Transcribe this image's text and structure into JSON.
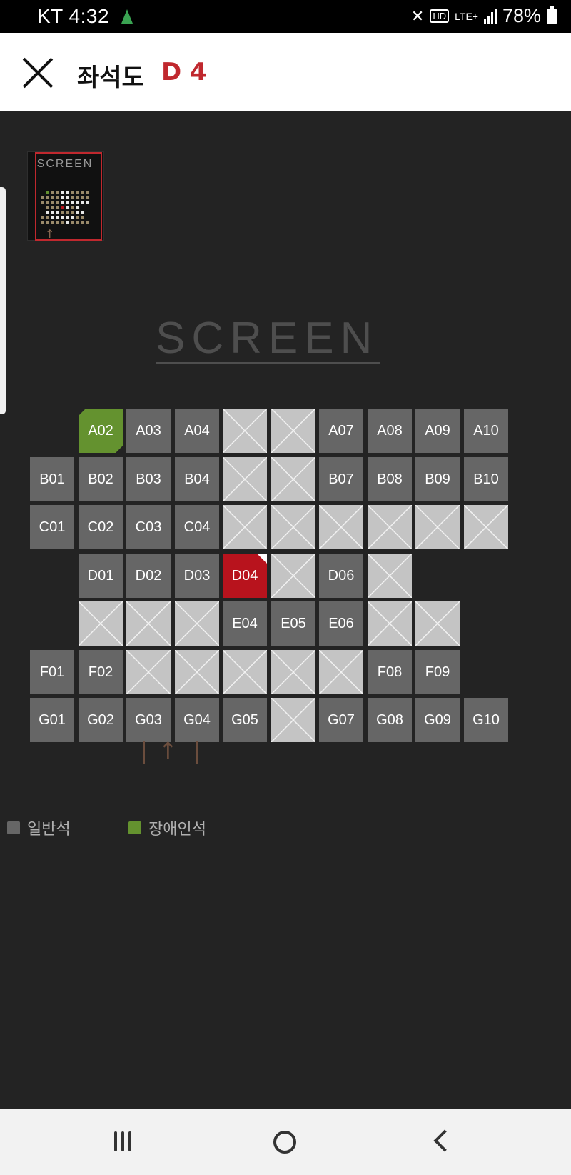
{
  "status": {
    "carrier_time": "KT 4:32",
    "hd": "HD",
    "lte": "LTE+",
    "battery": "78%"
  },
  "header": {
    "title": "좌석도",
    "seat": "D 4"
  },
  "minimap": {
    "screen_label": "SCREEN"
  },
  "screen": {
    "label": "SCREEN"
  },
  "seats": [
    {
      "id": "A02",
      "label": "A02",
      "status": "wheelchair",
      "row": 0,
      "col": 1
    },
    {
      "id": "A03",
      "label": "A03",
      "status": "available",
      "row": 0,
      "col": 2
    },
    {
      "id": "A04",
      "label": "A04",
      "status": "available",
      "row": 0,
      "col": 3
    },
    {
      "id": "A05",
      "label": "",
      "status": "blocked",
      "row": 0,
      "col": 4
    },
    {
      "id": "A06",
      "label": "",
      "status": "blocked",
      "row": 0,
      "col": 5
    },
    {
      "id": "A07",
      "label": "A07",
      "status": "available",
      "row": 0,
      "col": 6
    },
    {
      "id": "A08",
      "label": "A08",
      "status": "available",
      "row": 0,
      "col": 7
    },
    {
      "id": "A09",
      "label": "A09",
      "status": "available",
      "row": 0,
      "col": 8
    },
    {
      "id": "A10",
      "label": "A10",
      "status": "available",
      "row": 0,
      "col": 9
    },
    {
      "id": "B01",
      "label": "B01",
      "status": "available",
      "row": 1,
      "col": 0
    },
    {
      "id": "B02",
      "label": "B02",
      "status": "available",
      "row": 1,
      "col": 1
    },
    {
      "id": "B03",
      "label": "B03",
      "status": "available",
      "row": 1,
      "col": 2
    },
    {
      "id": "B04",
      "label": "B04",
      "status": "available",
      "row": 1,
      "col": 3
    },
    {
      "id": "B05",
      "label": "",
      "status": "blocked",
      "row": 1,
      "col": 4
    },
    {
      "id": "B06",
      "label": "",
      "status": "blocked",
      "row": 1,
      "col": 5
    },
    {
      "id": "B07",
      "label": "B07",
      "status": "available",
      "row": 1,
      "col": 6
    },
    {
      "id": "B08",
      "label": "B08",
      "status": "available",
      "row": 1,
      "col": 7
    },
    {
      "id": "B09",
      "label": "B09",
      "status": "available",
      "row": 1,
      "col": 8
    },
    {
      "id": "B10",
      "label": "B10",
      "status": "available",
      "row": 1,
      "col": 9
    },
    {
      "id": "C01",
      "label": "C01",
      "status": "available",
      "row": 2,
      "col": 0
    },
    {
      "id": "C02",
      "label": "C02",
      "status": "available",
      "row": 2,
      "col": 1
    },
    {
      "id": "C03",
      "label": "C03",
      "status": "available",
      "row": 2,
      "col": 2
    },
    {
      "id": "C04",
      "label": "C04",
      "status": "available",
      "row": 2,
      "col": 3
    },
    {
      "id": "C05",
      "label": "",
      "status": "blocked",
      "row": 2,
      "col": 4
    },
    {
      "id": "C06",
      "label": "",
      "status": "blocked",
      "row": 2,
      "col": 5
    },
    {
      "id": "C07",
      "label": "",
      "status": "blocked",
      "row": 2,
      "col": 6
    },
    {
      "id": "C08",
      "label": "",
      "status": "blocked",
      "row": 2,
      "col": 7
    },
    {
      "id": "C09",
      "label": "",
      "status": "blocked",
      "row": 2,
      "col": 8
    },
    {
      "id": "C10",
      "label": "",
      "status": "blocked",
      "row": 2,
      "col": 9
    },
    {
      "id": "D01",
      "label": "D01",
      "status": "available",
      "row": 3,
      "col": 1
    },
    {
      "id": "D02",
      "label": "D02",
      "status": "available",
      "row": 3,
      "col": 2
    },
    {
      "id": "D03",
      "label": "D03",
      "status": "available",
      "row": 3,
      "col": 3
    },
    {
      "id": "D04",
      "label": "D04",
      "status": "selected",
      "row": 3,
      "col": 4
    },
    {
      "id": "D05",
      "label": "",
      "status": "blocked",
      "row": 3,
      "col": 5
    },
    {
      "id": "D06",
      "label": "D06",
      "status": "available",
      "row": 3,
      "col": 6
    },
    {
      "id": "D07",
      "label": "",
      "status": "blocked",
      "row": 3,
      "col": 7
    },
    {
      "id": "E01",
      "label": "",
      "status": "blocked",
      "row": 4,
      "col": 1
    },
    {
      "id": "E02",
      "label": "",
      "status": "blocked",
      "row": 4,
      "col": 2
    },
    {
      "id": "E03",
      "label": "",
      "status": "blocked",
      "row": 4,
      "col": 3
    },
    {
      "id": "E04",
      "label": "E04",
      "status": "available",
      "row": 4,
      "col": 4
    },
    {
      "id": "E05",
      "label": "E05",
      "status": "available",
      "row": 4,
      "col": 5
    },
    {
      "id": "E06",
      "label": "E06",
      "status": "available",
      "row": 4,
      "col": 6
    },
    {
      "id": "E07",
      "label": "",
      "status": "blocked",
      "row": 4,
      "col": 7
    },
    {
      "id": "E08",
      "label": "",
      "status": "blocked",
      "row": 4,
      "col": 8
    },
    {
      "id": "F01",
      "label": "F01",
      "status": "available",
      "row": 5,
      "col": 0
    },
    {
      "id": "F02",
      "label": "F02",
      "status": "available",
      "row": 5,
      "col": 1
    },
    {
      "id": "F03",
      "label": "",
      "status": "blocked",
      "row": 5,
      "col": 2
    },
    {
      "id": "F04",
      "label": "",
      "status": "blocked",
      "row": 5,
      "col": 3
    },
    {
      "id": "F05",
      "label": "",
      "status": "blocked",
      "row": 5,
      "col": 4
    },
    {
      "id": "F06",
      "label": "",
      "status": "blocked",
      "row": 5,
      "col": 5
    },
    {
      "id": "F07",
      "label": "",
      "status": "blocked",
      "row": 5,
      "col": 6
    },
    {
      "id": "F08",
      "label": "F08",
      "status": "available",
      "row": 5,
      "col": 7
    },
    {
      "id": "F09",
      "label": "F09",
      "status": "available",
      "row": 5,
      "col": 8
    },
    {
      "id": "G01",
      "label": "G01",
      "status": "available",
      "row": 6,
      "col": 0
    },
    {
      "id": "G02",
      "label": "G02",
      "status": "available",
      "row": 6,
      "col": 1
    },
    {
      "id": "G03",
      "label": "G03",
      "status": "available",
      "row": 6,
      "col": 2
    },
    {
      "id": "G04",
      "label": "G04",
      "status": "available",
      "row": 6,
      "col": 3
    },
    {
      "id": "G05",
      "label": "G05",
      "status": "available",
      "row": 6,
      "col": 4
    },
    {
      "id": "G06",
      "label": "",
      "status": "blocked",
      "row": 6,
      "col": 5
    },
    {
      "id": "G07",
      "label": "G07",
      "status": "available",
      "row": 6,
      "col": 6
    },
    {
      "id": "G08",
      "label": "G08",
      "status": "available",
      "row": 6,
      "col": 7
    },
    {
      "id": "G09",
      "label": "G09",
      "status": "available",
      "row": 6,
      "col": 8
    },
    {
      "id": "G10",
      "label": "G10",
      "status": "available",
      "row": 6,
      "col": 9
    }
  ],
  "legend": {
    "general": {
      "label": "일반석",
      "color": "#666666"
    },
    "wheelchair": {
      "label": "장애인석",
      "color": "#64922f"
    }
  },
  "colors": {
    "selected": "#b8131d",
    "blocked": "#c4c4c4",
    "accent": "#c0282e"
  },
  "icons": [
    "close-icon",
    "tree-icon",
    "mute-icon",
    "signal-icon",
    "battery-icon",
    "entrance-arrow-icon",
    "recent-apps-icon",
    "home-icon",
    "back-icon"
  ]
}
